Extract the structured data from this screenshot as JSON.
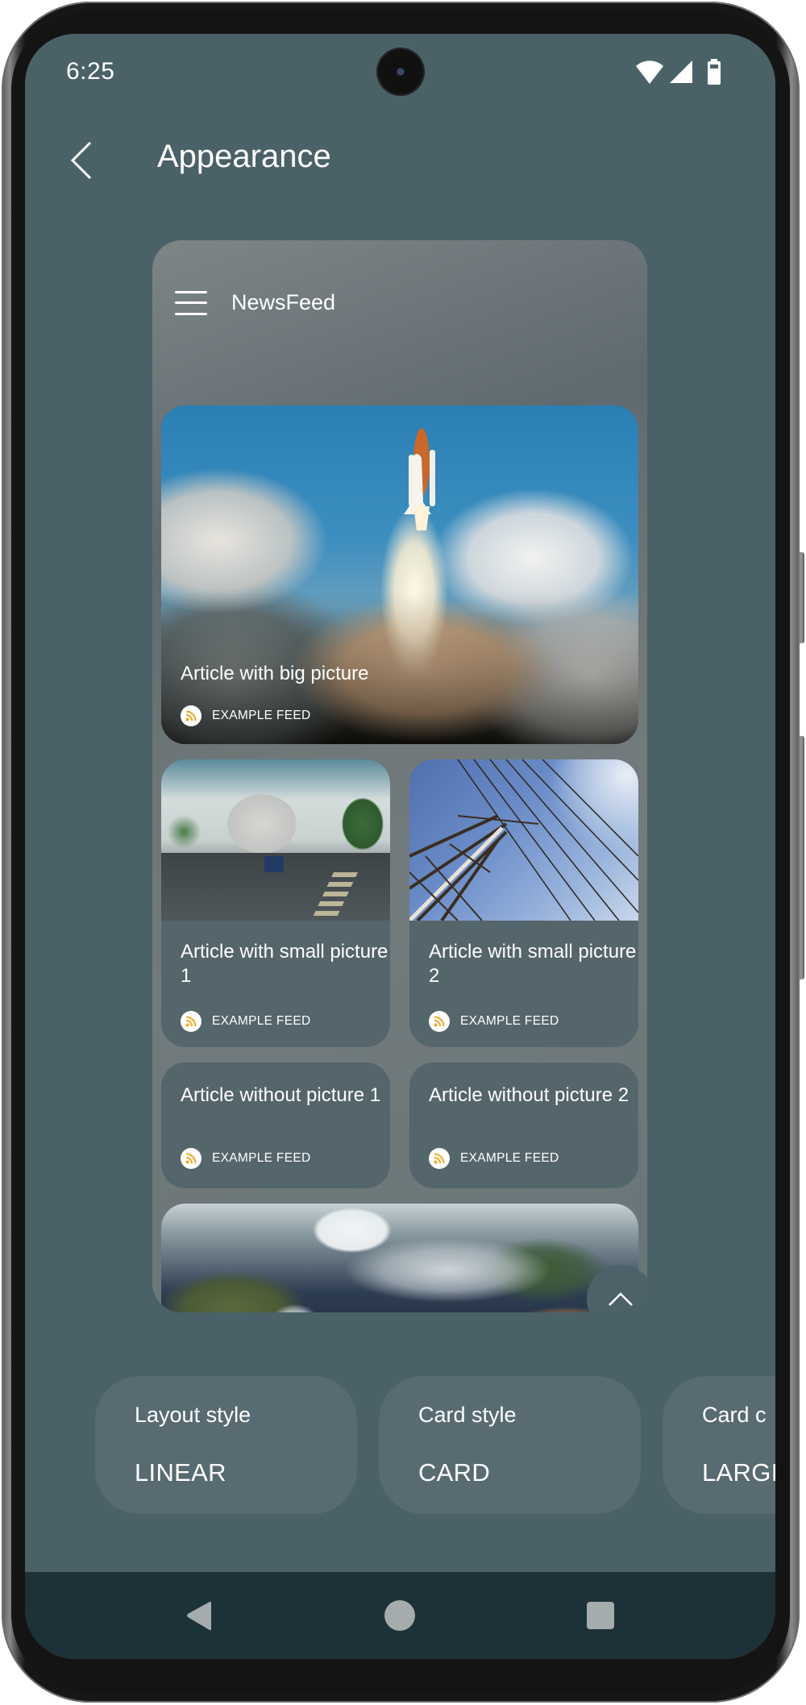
{
  "status_bar": {
    "time": "6:25",
    "icons": [
      "wifi-icon",
      "cellular-signal-icon",
      "battery-icon"
    ]
  },
  "app_bar": {
    "back_icon": "chevron-left-icon",
    "title": "Appearance"
  },
  "preview": {
    "menu_icon": "hamburger-menu-icon",
    "title": "NewsFeed",
    "articles": [
      {
        "title": "Article with big picture",
        "feed": "EXAMPLE FEED",
        "image": "space-shuttle-launch",
        "style": "big-picture"
      },
      {
        "title": "Article with small picture 1",
        "feed": "EXAMPLE FEED",
        "image": "city-street",
        "style": "small-picture"
      },
      {
        "title": "Article with small picture 2",
        "feed": "EXAMPLE FEED",
        "image": "power-line-tower",
        "style": "small-picture"
      },
      {
        "title": "Article without picture 1",
        "feed": "EXAMPLE FEED",
        "style": "no-picture"
      },
      {
        "title": "Article without picture 2",
        "feed": "EXAMPLE FEED",
        "style": "no-picture"
      },
      {
        "image": "earth-satellite-view",
        "style": "big-picture"
      }
    ],
    "feed_icon": "rss-icon",
    "scroll_top_icon": "chevron-up-icon"
  },
  "options": [
    {
      "label": "Layout style",
      "value": "LINEAR"
    },
    {
      "label": "Card style",
      "value": "CARD"
    },
    {
      "label": "Card c",
      "value": "LARGI"
    }
  ],
  "nav_bar": {
    "back_icon": "nav-back-icon",
    "home_icon": "nav-home-icon",
    "recents_icon": "nav-recents-icon"
  },
  "colors": {
    "background": "#4a6168",
    "card": "#54656b",
    "chip": "#586b72",
    "nav_bar": "#1c3238",
    "feed_icon_accent": "#f5a623",
    "text": "#ffffff"
  }
}
